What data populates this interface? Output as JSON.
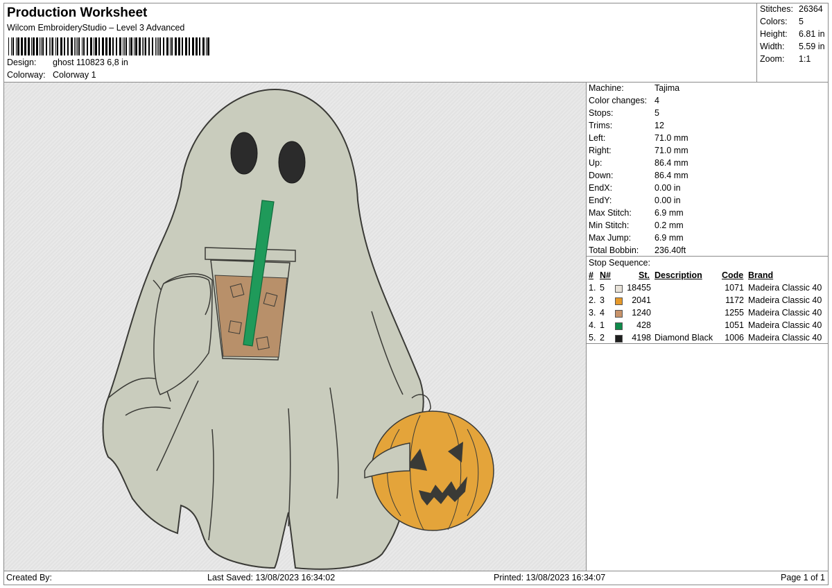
{
  "header": {
    "title": "Production Worksheet",
    "software": "Wilcom EmbroideryStudio – Level 3 Advanced",
    "design_label": "Design:",
    "design_value": "ghost 110823 6,8 in",
    "colorway_label": "Colorway:",
    "colorway_value": "Colorway 1"
  },
  "summary": [
    {
      "label": "Stitches:",
      "value": "26364"
    },
    {
      "label": "Colors:",
      "value": "5"
    },
    {
      "label": "Height:",
      "value": "6.81 in"
    },
    {
      "label": "Width:",
      "value": "5.59 in"
    },
    {
      "label": "Zoom:",
      "value": "1:1"
    }
  ],
  "machine_info": [
    {
      "label": "Machine:",
      "value": "Tajima"
    },
    {
      "label": "Color changes:",
      "value": "4"
    },
    {
      "label": "Stops:",
      "value": "5"
    },
    {
      "label": "Trims:",
      "value": "12"
    },
    {
      "label": "Left:",
      "value": "71.0 mm"
    },
    {
      "label": "Right:",
      "value": "71.0 mm"
    },
    {
      "label": "Up:",
      "value": "86.4 mm"
    },
    {
      "label": "Down:",
      "value": "86.4 mm"
    },
    {
      "label": "EndX:",
      "value": "0.00 in"
    },
    {
      "label": "EndY:",
      "value": "0.00 in"
    },
    {
      "label": "Max Stitch:",
      "value": "6.9 mm"
    },
    {
      "label": "Min Stitch:",
      "value": "0.2 mm"
    },
    {
      "label": "Max Jump:",
      "value": "6.9 mm"
    },
    {
      "label": "Total Bobbin:",
      "value": "236.40ft"
    }
  ],
  "stop_sequence": {
    "title": "Stop Sequence:",
    "columns": {
      "index": "#",
      "needle": "N#",
      "stitches": "St.",
      "description": "Description",
      "code": "Code",
      "brand": "Brand"
    },
    "rows": [
      {
        "index": "1.",
        "needle": "5",
        "color": "#e8e2d8",
        "stitches": "18455",
        "description": "",
        "code": "1071",
        "brand": "Madeira Classic 40"
      },
      {
        "index": "2.",
        "needle": "3",
        "color": "#e6992a",
        "stitches": "2041",
        "description": "",
        "code": "1172",
        "brand": "Madeira Classic 40"
      },
      {
        "index": "3.",
        "needle": "4",
        "color": "#c8936a",
        "stitches": "1240",
        "description": "",
        "code": "1255",
        "brand": "Madeira Classic 40"
      },
      {
        "index": "4.",
        "needle": "1",
        "color": "#0f8a4a",
        "stitches": "428",
        "description": "",
        "code": "1051",
        "brand": "Madeira Classic 40"
      },
      {
        "index": "5.",
        "needle": "2",
        "color": "#1e1e1e",
        "stitches": "4198",
        "description": "Diamond Black",
        "code": "1006",
        "brand": "Madeira Classic 40"
      }
    ]
  },
  "footer": {
    "created_by": "Created By:",
    "last_saved": "Last Saved: 13/08/2023 16:34:02",
    "printed": "Printed: 13/08/2023 16:34:07",
    "page": "Page 1 of 1"
  },
  "design_image": {
    "ghost_fill": "#c9ccbd",
    "outline": "#3a3a36",
    "coffee": "#b8906a",
    "straw": "#1f9a5a",
    "pumpkin": "#e4a43a"
  }
}
